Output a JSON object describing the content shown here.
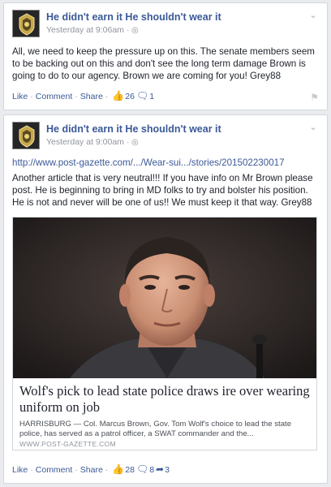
{
  "posts": [
    {
      "author": "He didn't earn it He shouldn't wear it",
      "timestamp": "Yesterday at 9:06am",
      "text": "All, we need to keep the pressure up on this. The senate members seem to be backing out on this and don't see the long term damage Brown is going to do to our agency. Brown we are coming for you! Grey88",
      "actions": {
        "like": "Like",
        "comment": "Comment",
        "share": "Share",
        "likes_count": "26",
        "comments_count": "1"
      }
    },
    {
      "author": "He didn't earn it He shouldn't wear it",
      "timestamp": "Yesterday at 9:00am",
      "link_url": "http://www.post-gazette.com/.../Wear-sui.../stories/201502230017",
      "text": "Another article that is very neutral!!! If you have info on Mr Brown please post. He is beginning to bring in MD folks to try and bolster his position. He is not and never will be one of us!! We must keep it that way. Grey88",
      "link_card": {
        "title": "Wolf's pick to lead state police draws ire over wearing uniform on job",
        "description": "HARRISBURG — Col. Marcus Brown, Gov. Tom Wolf's choice to lead the state police, has served as a patrol officer, a SWAT commander and the...",
        "source": "WWW.POST-GAZETTE.COM"
      },
      "actions": {
        "like": "Like",
        "comment": "Comment",
        "share": "Share",
        "likes_count": "28",
        "comments_count": "8",
        "shares_count": "3"
      }
    }
  ],
  "icons": {
    "globe": "globe-icon",
    "chevron": "chevron-down-icon",
    "like": "thumbs-up-icon",
    "comment": "comment-icon",
    "share": "share-arrow-icon",
    "flag": "flag-icon"
  },
  "colors": {
    "link": "#3b5998",
    "meta": "#90949c",
    "background": "#e9ebee"
  }
}
